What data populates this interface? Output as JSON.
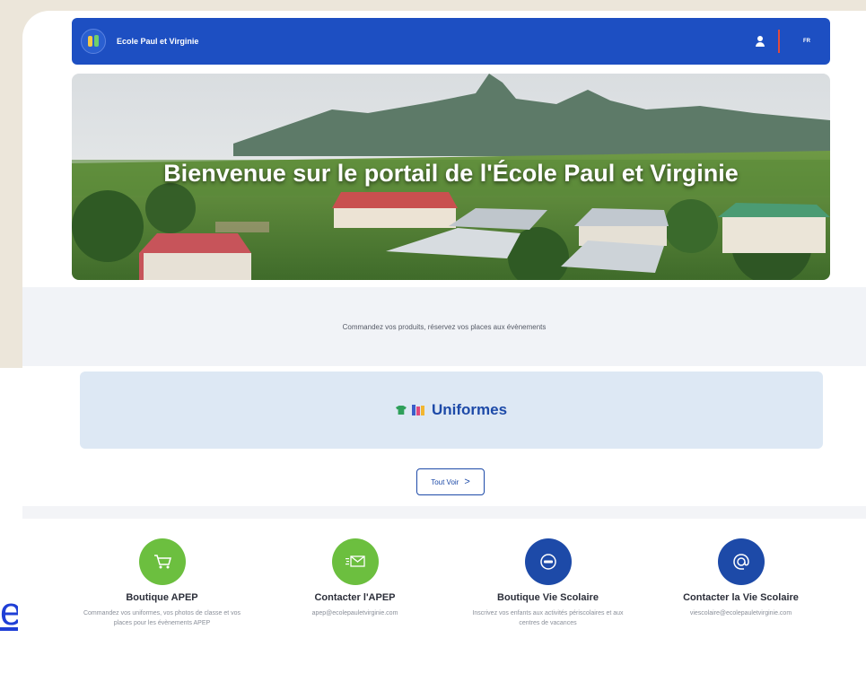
{
  "header": {
    "school_name": "Ecole Paul et Virginie",
    "language": "FR"
  },
  "hero": {
    "title": "Bienvenue sur le portail de l'École Paul et Virginie"
  },
  "subheader": {
    "text": "Commandez vos produits, réservez vos places aux évènements"
  },
  "category": {
    "label": "Uniformes"
  },
  "see_all": {
    "label": "Tout Voir",
    "chevron": ">"
  },
  "features": [
    {
      "title": "Boutique APEP",
      "desc": "Commandez vos uniformes, vos photos de classe et vos places pour les évènements APEP",
      "icon": "cart-icon",
      "color": "#6cbf3f"
    },
    {
      "title": "Contacter l'APEP",
      "desc": "apep@ecolepauletvirginie.com",
      "icon": "mail-icon",
      "color": "#6cbf3f"
    },
    {
      "title": "Boutique Vie Scolaire",
      "desc": "Inscrivez vos enfants aux activités périscolaires et aux centres de vacances",
      "icon": "ticket-icon",
      "color": "#1d4aa8"
    },
    {
      "title": "Contacter la Vie Scolaire",
      "desc": "viescolaire@ecolepauletvirginie.com",
      "icon": "at-icon",
      "color": "#1d4aa8"
    }
  ],
  "colors": {
    "primary": "#1d4fc2",
    "green": "#6cbf3f",
    "accent_red": "#e24b3c"
  }
}
